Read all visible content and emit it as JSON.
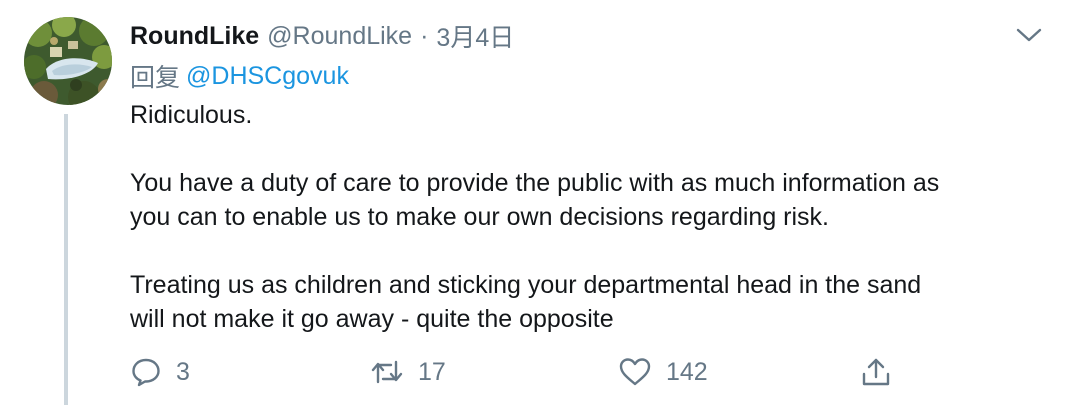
{
  "tweet": {
    "display_name": "RoundLike",
    "handle": "@RoundLike",
    "separator": "·",
    "date": "3月4日",
    "reply_prefix": "回复",
    "reply_to": "@DHSCgovuk",
    "body_lines": [
      "Ridiculous.",
      "You have a duty of care to provide the public with as much information as",
      "you can to enable us to make our own decisions regarding risk.",
      "Treating us as children and sticking your departmental head in the sand",
      "will not make it go away - quite the opposite"
    ]
  },
  "actions": {
    "reply_count": "3",
    "retweet_count": "17",
    "like_count": "142"
  },
  "icons": {
    "avatar": "avatar-image",
    "caret": "chevron-down-icon",
    "reply": "reply-bubble-icon",
    "retweet": "retweet-icon",
    "like": "heart-icon",
    "share": "share-icon"
  },
  "colors": {
    "text_primary": "#14171a",
    "text_secondary": "#657786",
    "link": "#1b95e0",
    "thread_line": "#ccd6dd"
  }
}
